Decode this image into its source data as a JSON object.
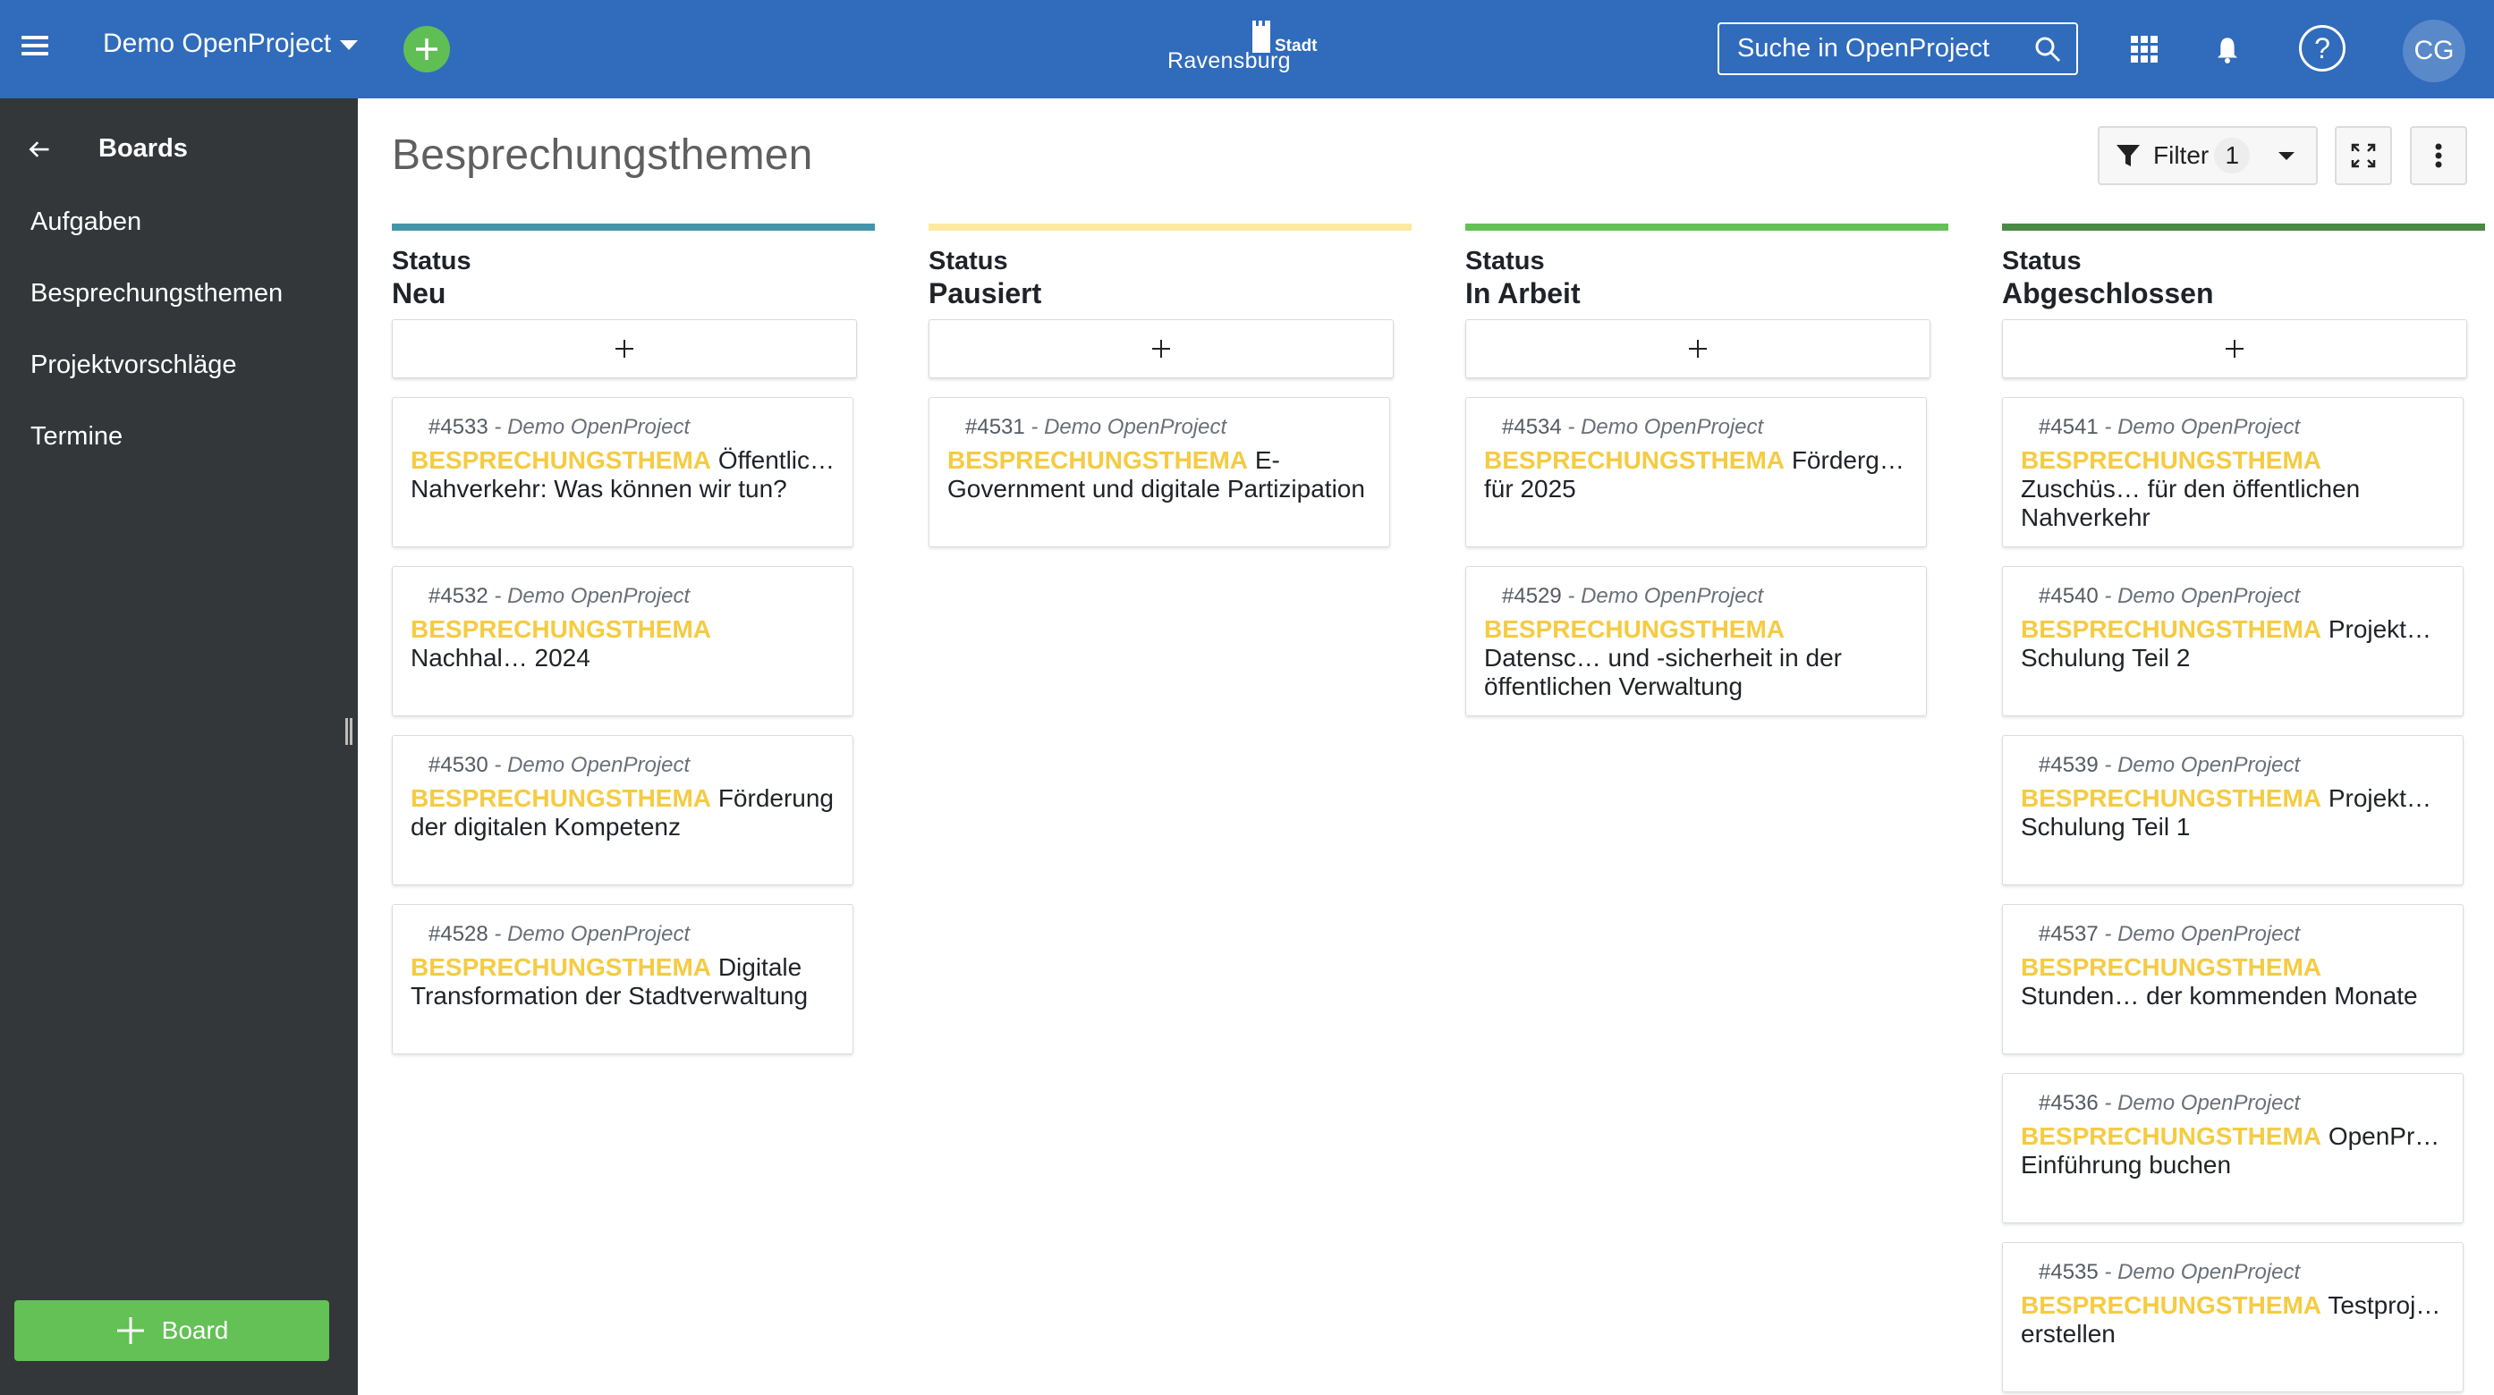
{
  "topbar": {
    "project_name": "Demo OpenProject",
    "logo_small": "Stadt",
    "logo_city": "Ravensburg",
    "search_placeholder": "Suche in OpenProject",
    "avatar_initials": "CG",
    "help_glyph": "?"
  },
  "sidebar": {
    "title": "Boards",
    "items": [
      {
        "label": "Aufgaben"
      },
      {
        "label": "Besprechungsthemen"
      },
      {
        "label": "Projektvorschläge"
      },
      {
        "label": "Termine"
      }
    ],
    "new_board_label": "Board"
  },
  "main": {
    "title": "Besprechungsthemen",
    "filter_label": "Filter",
    "filter_count": "1",
    "columns": [
      {
        "kicker": "Status",
        "name": "Neu",
        "color": "#4595aa",
        "cards": [
          {
            "id": "#4533",
            "project": "- Demo OpenProject",
            "type": "BESPRECHUNGSTHEMA",
            "title": "Öffentlic… Nahverkehr: Was können wir tun?"
          },
          {
            "id": "#4532",
            "project": "- Demo OpenProject",
            "type": "BESPRECHUNGSTHEMA",
            "title": "Nachhal… 2024"
          },
          {
            "id": "#4530",
            "project": "- Demo OpenProject",
            "type": "BESPRECHUNGSTHEMA",
            "title": "Förderung der digitalen Kompetenz"
          },
          {
            "id": "#4528",
            "project": "- Demo OpenProject",
            "type": "BESPRECHUNGSTHEMA",
            "title": "Digitale Transformation der Stadtverwaltung"
          }
        ]
      },
      {
        "kicker": "Status",
        "name": "Pausiert",
        "color": "#fdeaa0",
        "cards": [
          {
            "id": "#4531",
            "project": "- Demo OpenProject",
            "type": "BESPRECHUNGSTHEMA",
            "title": "E-Government und digitale Partizipation"
          }
        ]
      },
      {
        "kicker": "Status",
        "name": "In Arbeit",
        "color": "#62c254",
        "cards": [
          {
            "id": "#4534",
            "project": "- Demo OpenProject",
            "type": "BESPRECHUNGSTHEMA",
            "title": "Förderg… für 2025"
          },
          {
            "id": "#4529",
            "project": "- Demo OpenProject",
            "type": "BESPRECHUNGSTHEMA",
            "title": "Datensc… und -sicherheit in der öffentlichen Verwaltung"
          }
        ]
      },
      {
        "kicker": "Status",
        "name": "Abgeschlossen",
        "color": "#4a8a46",
        "cards": [
          {
            "id": "#4541",
            "project": "- Demo OpenProject",
            "type": "BESPRECHUNGSTHEMA",
            "title": "Zuschüs… für den öffentlichen Nahverkehr"
          },
          {
            "id": "#4540",
            "project": "- Demo OpenProject",
            "type": "BESPRECHUNGSTHEMA",
            "title": "Projekt… Schulung Teil 2"
          },
          {
            "id": "#4539",
            "project": "- Demo OpenProject",
            "type": "BESPRECHUNGSTHEMA",
            "title": "Projekt… Schulung Teil 1"
          },
          {
            "id": "#4537",
            "project": "- Demo OpenProject",
            "type": "BESPRECHUNGSTHEMA",
            "title": "Stunden… der kommenden Monate"
          },
          {
            "id": "#4536",
            "project": "- Demo OpenProject",
            "type": "BESPRECHUNGSTHEMA",
            "title": "OpenPr… Einführung buchen"
          },
          {
            "id": "#4535",
            "project": "- Demo OpenProject",
            "type": "BESPRECHUNGSTHEMA",
            "title": "Testproj… erstellen"
          }
        ]
      }
    ]
  },
  "colors": {
    "header": "#306bbc",
    "sidebar": "#333739",
    "accent_green": "#63c155",
    "type_label": "#f5cb42"
  }
}
